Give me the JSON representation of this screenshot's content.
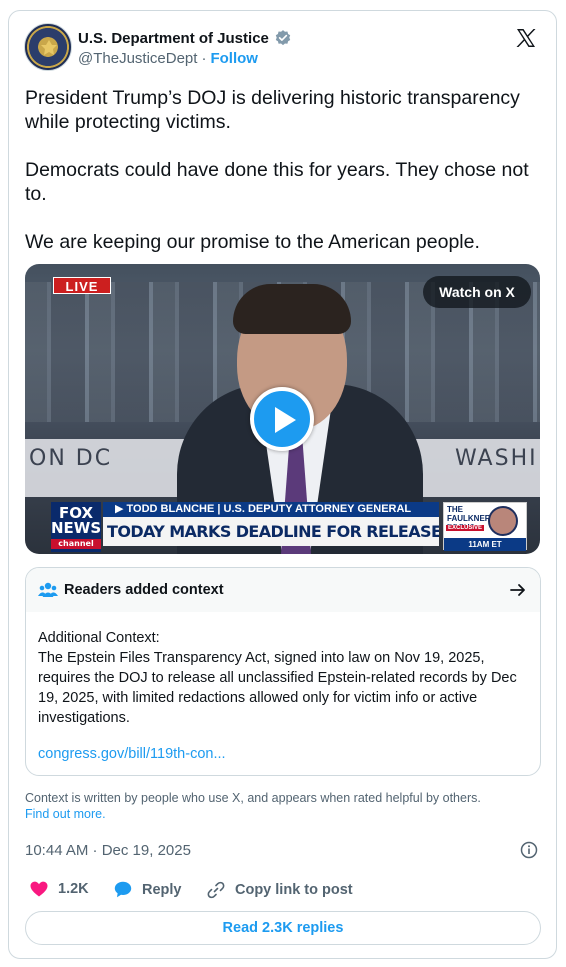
{
  "account": {
    "name": "U.S. Department of Justice",
    "handle": "@TheJusticeDept",
    "separator": "·",
    "follow_label": "Follow",
    "verified": true
  },
  "tweet": {
    "paragraphs": [
      "President Trump’s DOJ is delivering historic transparency while protecting victims.",
      "Democrats could have done this for years. They chose not to.",
      "We are keeping our promise to the American people."
    ],
    "timestamp": "10:44 AM · Dec 19, 2025"
  },
  "video": {
    "live_badge": "LIVE",
    "watch_label": "Watch on X",
    "background_text_left": "ON DC",
    "background_text_right": "WASHI",
    "network_logo": "FOX NEWS",
    "network_sub": "channel",
    "name_strip": "▶ TODD BLANCHE | U.S. DEPUTY ATTORNEY GENERAL",
    "headline": "TODAY MARKS DEADLINE FOR RELEASE OF EPSTEIN FILES",
    "show_title": "THE FAULKNER FOCUS",
    "show_exclusive": "EXCLUSIVE",
    "show_time": "11AM ET"
  },
  "context": {
    "title": "Readers added context",
    "body_heading": "Additional Context:",
    "body": "The Epstein Files Transparency Act, signed into law on Nov 19, 2025, requires the DOJ to release all unclassified Epstein-related records by Dec 19, 2025, with limited redactions allowed only for victim info or active investigations.",
    "link": "congress.gov/bill/119th-con...",
    "note": "Context is written by people who use X, and appears when rated helpful by others.",
    "find_out_more": "Find out more."
  },
  "actions": {
    "like_count": "1.2K",
    "reply_label": "Reply",
    "copy_label": "Copy link to post",
    "read_replies": "Read 2.3K replies"
  },
  "colors": {
    "accent": "#1d9bf0",
    "like": "#f91880",
    "muted": "#536471",
    "text": "#0f1419"
  },
  "icons": [
    "doj-seal-avatar",
    "verified-badge-icon",
    "x-logo-icon",
    "play-icon",
    "readers-icon",
    "arrow-right-icon",
    "info-icon",
    "heart-icon",
    "reply-bubble-icon",
    "link-icon"
  ]
}
